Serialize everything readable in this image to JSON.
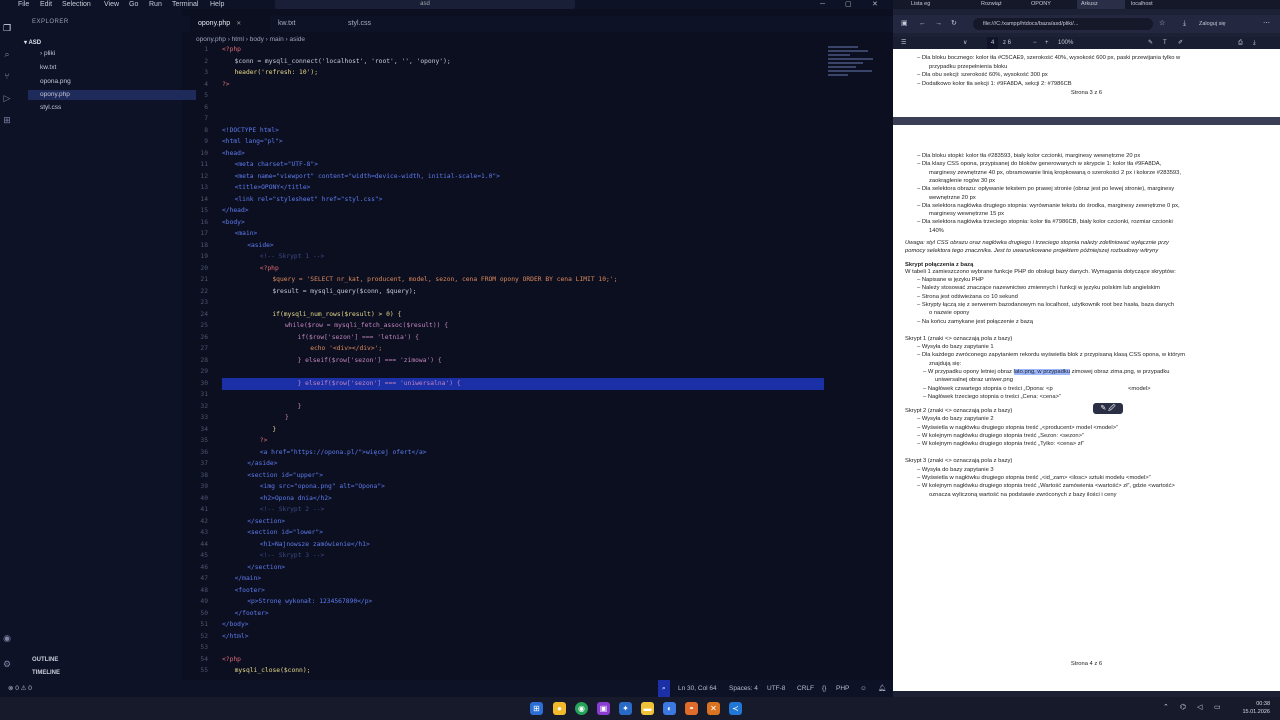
{
  "vscode": {
    "menu": [
      "File",
      "Edit",
      "Selection",
      "View",
      "Go",
      "Run",
      "Terminal",
      "Help"
    ],
    "search_text": "asd",
    "explorer_title": "EXPLORER",
    "folder": "ASD",
    "files": [
      "pliki",
      "kw.txt",
      "opona.png",
      "opony.php",
      "styl.css"
    ],
    "selected_file": "opony.php",
    "outline": "OUTLINE",
    "timeline": "TIMELINE",
    "tabs": [
      "opony.php",
      "kw.txt",
      "styl.css"
    ],
    "breadcrumb": [
      "opony.php",
      "html",
      "body",
      "main",
      "aside"
    ],
    "lines": [
      {
        "n": "1",
        "t": "<?php",
        "c": "pp",
        "i": 0
      },
      {
        "n": "2",
        "t": "$conn = mysqli_connect('localhost', 'root', '', 'opony');",
        "c": "plain",
        "i": 2
      },
      {
        "n": "3",
        "t": "header('refresh: 10');",
        "c": "fn",
        "i": 2
      },
      {
        "n": "4",
        "t": "?>",
        "c": "pp",
        "i": 0
      },
      {
        "n": "5",
        "t": "",
        "c": "plain",
        "i": 0
      },
      {
        "n": "6",
        "t": "",
        "c": "plain",
        "i": 0
      },
      {
        "n": "7",
        "t": "",
        "c": "plain",
        "i": 0
      },
      {
        "n": "8",
        "t": "<!DOCTYPE html>",
        "c": "tg",
        "i": 0
      },
      {
        "n": "9",
        "t": "<html lang=\"pl\">",
        "c": "tg",
        "i": 0
      },
      {
        "n": "10",
        "t": "<head>",
        "c": "tg",
        "i": 0
      },
      {
        "n": "11",
        "t": "<meta charset=\"UTF-8\">",
        "c": "tg",
        "i": 2
      },
      {
        "n": "12",
        "t": "<meta name=\"viewport\" content=\"width=device-width, initial-scale=1.0\">",
        "c": "tg",
        "i": 2
      },
      {
        "n": "13",
        "t": "<title>OPONY</title>",
        "c": "tg",
        "i": 2
      },
      {
        "n": "14",
        "t": "<link rel=\"stylesheet\" href=\"styl.css\">",
        "c": "tg",
        "i": 2
      },
      {
        "n": "15",
        "t": "</head>",
        "c": "tg",
        "i": 0
      },
      {
        "n": "16",
        "t": "<body>",
        "c": "tg",
        "i": 0
      },
      {
        "n": "17",
        "t": "<main>",
        "c": "tg",
        "i": 2
      },
      {
        "n": "18",
        "t": "<aside>",
        "c": "tg",
        "i": 4
      },
      {
        "n": "19",
        "t": "<!-- Skrypt 1 -->",
        "c": "cm",
        "i": 6
      },
      {
        "n": "20",
        "t": "<?php",
        "c": "pp",
        "i": 6
      },
      {
        "n": "21",
        "t": "$query = 'SELECT nr_kat, producent, model, sezon, cena FROM opony ORDER BY cena LIMIT 10;';",
        "c": "st",
        "i": 8
      },
      {
        "n": "22",
        "t": "$result = mysqli_query($conn, $query);",
        "c": "plain",
        "i": 8
      },
      {
        "n": "23",
        "t": "",
        "c": "plain",
        "i": 0
      },
      {
        "n": "24",
        "t": "if(mysqli_num_rows($result) > 0) {",
        "c": "fn",
        "i": 8
      },
      {
        "n": "25",
        "t": "while($row = mysqli_fetch_assoc($result)) {",
        "c": "kw",
        "i": 10
      },
      {
        "n": "26",
        "t": "if($row['sezon'] === 'letnia') {",
        "c": "kw",
        "i": 12
      },
      {
        "n": "27",
        "t": "echo '<div></div>';",
        "c": "st",
        "i": 14
      },
      {
        "n": "28",
        "t": "} elseif($row['sezon'] === 'zimowa') {",
        "c": "kw",
        "i": 12
      },
      {
        "n": "29",
        "t": "",
        "c": "plain",
        "i": 0
      },
      {
        "n": "30",
        "t": "} elseif($row['sezon'] === 'uniwersalna') {",
        "c": "kw",
        "i": 12
      },
      {
        "n": "31",
        "t": "",
        "c": "plain",
        "i": 0
      },
      {
        "n": "32",
        "t": "}",
        "c": "kw",
        "i": 12
      },
      {
        "n": "33",
        "t": "}",
        "c": "kw",
        "i": 10
      },
      {
        "n": "34",
        "t": "}",
        "c": "fn",
        "i": 8
      },
      {
        "n": "35",
        "t": "?>",
        "c": "pp",
        "i": 6
      },
      {
        "n": "36",
        "t": "<a href=\"https://opona.pl/\">więcej ofert</a>",
        "c": "tg",
        "i": 6
      },
      {
        "n": "37",
        "t": "</aside>",
        "c": "tg",
        "i": 4
      },
      {
        "n": "38",
        "t": "<section id=\"upper\">",
        "c": "tg",
        "i": 4
      },
      {
        "n": "39",
        "t": "<img src=\"opona.png\" alt=\"Opona\">",
        "c": "tg",
        "i": 6
      },
      {
        "n": "40",
        "t": "<h2>Opona dnia</h2>",
        "c": "tg",
        "i": 6
      },
      {
        "n": "41",
        "t": "<!-- Skrypt 2 -->",
        "c": "cm",
        "i": 6
      },
      {
        "n": "42",
        "t": "</section>",
        "c": "tg",
        "i": 4
      },
      {
        "n": "43",
        "t": "<section id=\"lower\">",
        "c": "tg",
        "i": 4
      },
      {
        "n": "44",
        "t": "<h1>Najnowsze zamówienie</h1>",
        "c": "tg",
        "i": 6
      },
      {
        "n": "45",
        "t": "<!-- Skrypt 3 -->",
        "c": "cm",
        "i": 6
      },
      {
        "n": "46",
        "t": "</section>",
        "c": "tg",
        "i": 4
      },
      {
        "n": "47",
        "t": "</main>",
        "c": "tg",
        "i": 2
      },
      {
        "n": "48",
        "t": "<footer>",
        "c": "tg",
        "i": 2
      },
      {
        "n": "49",
        "t": "<p>Stronę wykonał: 1234567890</p>",
        "c": "tg",
        "i": 4
      },
      {
        "n": "50",
        "t": "</footer>",
        "c": "tg",
        "i": 2
      },
      {
        "n": "51",
        "t": "</body>",
        "c": "tg",
        "i": 0
      },
      {
        "n": "52",
        "t": "</html>",
        "c": "tg",
        "i": 0
      },
      {
        "n": "53",
        "t": "",
        "c": "plain",
        "i": 0
      },
      {
        "n": "54",
        "t": "<?php",
        "c": "pp",
        "i": 0
      },
      {
        "n": "55",
        "t": "mysqli_close($conn);",
        "c": "fn",
        "i": 2
      }
    ],
    "active_line": "30",
    "status": {
      "errors": "⊗ 0 ⚠ 0",
      "position": "Ln 30, Col 64",
      "spaces": "Spaces: 4",
      "encoding": "UTF-8",
      "eol": "CRLF",
      "lang_braces": "{}",
      "lang": "PHP"
    }
  },
  "browser": {
    "tabs": [
      "Lista eg",
      "Rozwiąż",
      "OPONY",
      "Arkusz",
      "localhost"
    ],
    "active_tab": "Arkusz",
    "url": "file:///C:/xampp/htdocs/baza/asd/pliki/...",
    "login": "Zaloguj się",
    "pdf_page": "4",
    "pdf_pages": "z 6",
    "zoom": "100%",
    "page3_lines": [
      "Dla bloku bocznego: kolor tła #C5CAE9, szerokość 40%, wysokość 600 px, paski przewijania tylko w",
      "przypadku przepełnienia bloku",
      "Dla obu sekcji: szerokość 60%, wysokość 300 px",
      "Dodatkowo kolor tła sekcji 1: #9FA8DA, sekcji 2: #7986CB"
    ],
    "page3_footer": "Strona 3 z 6",
    "page4": {
      "style_lines": [
        "Dla bloku stopki: kolor tła #283593, biały kolor czcionki, marginesy wewnętrzne 20 px",
        "Dla klasy CSS opona, przypisanej do bloków generowanych w skrypcie 1: kolor tła #9FA8DA,",
        "marginesy zewnętrzne 40 px, obramowanie linią kropkowaną o szerokości 2 px i kolorze #283593,",
        "zaokrąglenie rogów 30 px",
        "Dla selektora obrazu: opływanie tekstem po prawej stronie (obraz jest po lewej stronie), marginesy",
        "wewnętrzne 20 px",
        "Dla selektora nagłówka drugiego stopnia: wyrównanie tekstu do środka, marginesy zewnętrzne 0 px,",
        "marginesy wewnętrzne 15 px",
        "Dla selektora nagłówka trzeciego stopnia: kolor tła #7986CB, biały kolor czcionki, rozmiar czcionki",
        "140%"
      ],
      "note": "Uwaga: styl CSS obrazu oraz nagłówka drugiego i trzeciego stopnia należy zdefiniować wyłącznie przy",
      "note2": "pomocy selektora tego znacznika. Jest to uwarunkowane projektem późniejszej rozbudowy witryny",
      "heading": "Skrypt połączenia z bazą",
      "intro": "W tabeli 1 zamieszczono wybrane funkcje PHP do obsługi bazy danych. Wymagania dotyczące skryptów:",
      "reqs": [
        "Napisane w języku PHP",
        "Należy stosować znaczące nazewnictwo zmiennych i funkcji w języku polskim lub angielskim",
        "Strona jest odświeżana co 10 sekund",
        "Skrypty łączą się z serwerem bazodanowym na localhost, użytkownik root bez hasła, baza danych",
        "o nazwie opony",
        "Na końcu zamykane jest połączenie z bazą"
      ],
      "s1_title": "Skrypt 1 (znaki <> oznaczają pola z bazy)",
      "s1": [
        "Wysyła do bazy zapytanie 1",
        "Dla każdego zwróconego zapytaniem rekordu wyświetla blok z przypisaną klasą CSS opona, w którym",
        "znajdują się:"
      ],
      "s1_sub1a": "W przypadku opony letniej obraz ",
      "s1_sub1hl": "lato.png, w przypadku",
      "s1_sub1b": " zimowej obraz zima.png, w przypadku",
      "s1_sub1c": "uniwersalnej obraz uniwer.png",
      "s1_sub2": "Nagłówek czwartego stopnia o treści „Opona: <p",
      "s1_sub2b": "<model>",
      "s1_sub3": "Nagłówek trzeciego stopnia o treści „Cena: <cena>”",
      "s2_title": "Skrypt 2 (znaki <> oznaczają pola z bazy)",
      "s2": [
        "Wysyła do bazy zapytanie 2",
        "Wyświetla w nagłówku drugiego stopnia treść „<producent> model <model>”",
        "W kolejnym nagłówku drugiego stopnia treść „Sezon: <sezon>”",
        "W kolejnym nagłówku drugiego stopnia treść „Tylko: <cena> zł”"
      ],
      "s3_title": "Skrypt 3 (znaki <> oznaczają pola z bazy)",
      "s3": [
        "Wysyła do bazy zapytanie 3",
        "Wyświetla w nagłówku drugiego stopnia treść „<id_zam> <ilosc> sztuki modelu <model>”",
        "W kolejnym nagłówku drugiego stopnia treść „Wartość zamówienia <wartość> zł”, gdzie <wartość>",
        "oznacza wyliczoną wartość na podstawie zwróconych z bazy ilości i ceny"
      ],
      "footer": "Strona 4 z 6"
    }
  },
  "taskbar": {
    "time": "00:38",
    "date": "15.01.2026"
  },
  "colors": {
    "accent": "#1b2fa6",
    "editor_bg": "#0b0f20",
    "sidebar_bg": "#0e1226"
  }
}
